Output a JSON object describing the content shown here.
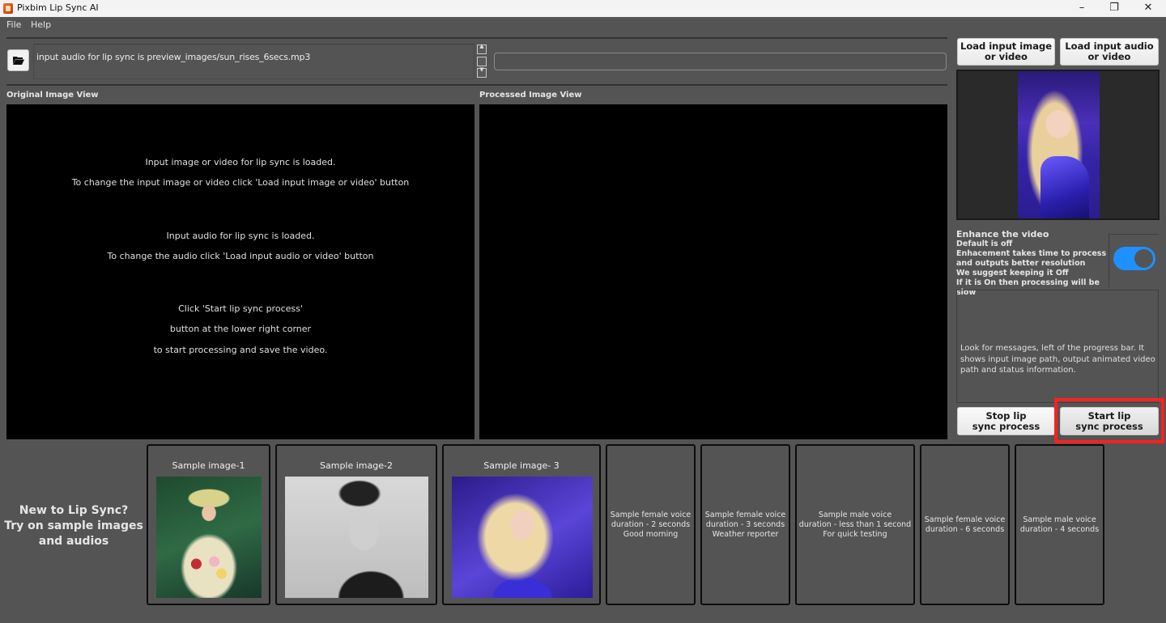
{
  "window": {
    "title": "Pixbim Lip Sync AI",
    "controls": [
      "minimize",
      "restore",
      "close"
    ]
  },
  "menu": [
    "File",
    "Help"
  ],
  "top_bar": {
    "folder_icon": "folder-open-icon",
    "path_message": "input audio for lip sync is preview_images/sun_rises_6secs.mp3",
    "progress_percent": 0
  },
  "views": {
    "original_label": "Original Image View",
    "processed_label": "Processed Image View",
    "original_messages": [
      "Input image or video for lip sync is loaded.",
      "To change the input image or video click 'Load input image or video' button",
      "Input audio for lip sync is loaded.",
      "To change the audio click 'Load input audio or video' button",
      "Click 'Start lip sync process'",
      "button at the lower right corner",
      "to start processing and save the video."
    ]
  },
  "right_panel": {
    "load_image_button": "Load input image\nor video",
    "load_audio_button": "Load input audio\nor video",
    "enhance": {
      "title": "Enhance the video",
      "lines": [
        "Default is off",
        "Enhacement takes time to process",
        "and outputs better resolution",
        "We suggest keeping it Off",
        "If it is On then processing will be slow"
      ],
      "toggle_on": true,
      "toggle_color": "#1e90ff"
    },
    "info_text": "Look for messages, left of the progress bar. It shows input image path, output animated video path and status information.",
    "stop_button": "Stop lip\nsync process",
    "start_button": "Start lip\nsync process",
    "highlight_color": "#ff2020"
  },
  "samples": {
    "cta": "New to Lip Sync?\nTry on sample images\nand audios",
    "images": [
      {
        "label": "Sample image-1"
      },
      {
        "label": "Sample image-2"
      },
      {
        "label": "Sample image- 3"
      }
    ],
    "voices": [
      {
        "text": "Sample female voice\nduration - 2 seconds\nGood morning"
      },
      {
        "text": "Sample female voice\nduration - 3 seconds\nWeather reporter"
      },
      {
        "text": "Sample male voice\nduration - less than 1 second\nFor quick testing"
      },
      {
        "text": "Sample female voice\nduration - 6 seconds"
      },
      {
        "text": "Sample male voice\nduration - 4 seconds"
      }
    ]
  }
}
